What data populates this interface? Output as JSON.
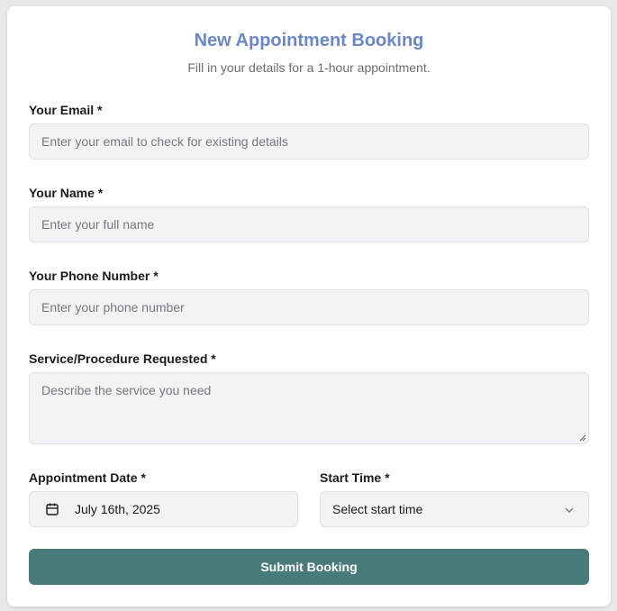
{
  "header": {
    "title": "New Appointment Booking",
    "subtitle": "Fill in your details for a 1-hour appointment."
  },
  "form": {
    "email": {
      "label": "Your Email *",
      "placeholder": "Enter your email to check for existing details",
      "value": ""
    },
    "name": {
      "label": "Your Name *",
      "placeholder": "Enter your full name",
      "value": ""
    },
    "phone": {
      "label": "Your Phone Number *",
      "placeholder": "Enter your phone number",
      "value": ""
    },
    "service": {
      "label": "Service/Procedure Requested *",
      "placeholder": "Describe the service you need",
      "value": ""
    },
    "date": {
      "label": "Appointment Date *",
      "value": "July 16th, 2025",
      "icon": "calendar-icon"
    },
    "start_time": {
      "label": "Start Time *",
      "value": "Select start time",
      "icon": "chevron-down-icon"
    },
    "submit_label": "Submit Booking"
  },
  "colors": {
    "title": "#6b86c9",
    "submit_bg": "#487b7a",
    "field_bg": "#f3f3f5"
  }
}
